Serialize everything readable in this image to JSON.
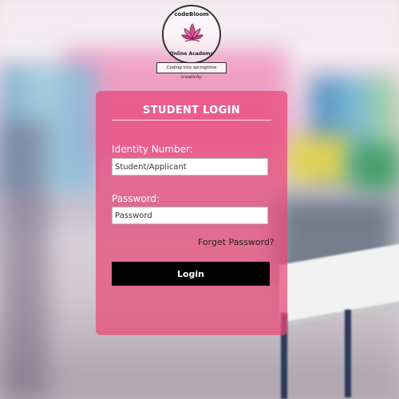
{
  "brand": {
    "name": "codeBloom",
    "subtitle": "Online Academy",
    "tagline": "Coding into springtime creativity",
    "accent_color": "#e9467a"
  },
  "login": {
    "title": "STUDENT LOGIN",
    "identity_label": "Identity Number:",
    "identity_placeholder": "Student/Applicant",
    "password_label": "Password:",
    "password_placeholder": "Password",
    "forgot_link": "Forget Password?",
    "login_button": "Login"
  }
}
